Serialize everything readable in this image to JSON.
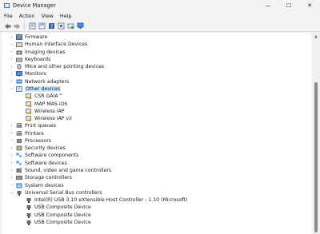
{
  "window": {
    "title": "Device Manager",
    "minimize_glyph": "—",
    "maximize_glyph": "☐",
    "close_glyph": "✕"
  },
  "menu": [
    "File",
    "Action",
    "View",
    "Help"
  ],
  "toolbar": {
    "icons": [
      "back-icon",
      "forward-icon",
      "properties-icon",
      "view-icon",
      "help-icon",
      "update-driver-icon",
      "scan-icon",
      "monitor-icon"
    ]
  },
  "tree": {
    "items": [
      {
        "label": "Firmware",
        "indent": 0,
        "expander": "›",
        "icon": "firmware-icon"
      },
      {
        "label": "Human Interface Devices",
        "indent": 0,
        "expander": "›",
        "icon": "hid-icon"
      },
      {
        "label": "Imaging devices",
        "indent": 0,
        "expander": "›",
        "icon": "camera-icon"
      },
      {
        "label": "Keyboards",
        "indent": 0,
        "expander": "›",
        "icon": "keyboard-icon"
      },
      {
        "label": "Mice and other pointing devices",
        "indent": 0,
        "expander": "›",
        "icon": "mouse-icon"
      },
      {
        "label": "Monitors",
        "indent": 0,
        "expander": "›",
        "icon": "monitor-icon"
      },
      {
        "label": "Network adapters",
        "indent": 0,
        "expander": "›",
        "icon": "network-icon"
      },
      {
        "label": "Other devices",
        "indent": 0,
        "expander": "⌄",
        "icon": "unknown-device-icon",
        "selected": true
      },
      {
        "label": "CSR GAIA™",
        "indent": 1,
        "expander": "",
        "icon": "warning-device-icon"
      },
      {
        "label": "MAP MAS-iOS",
        "indent": 1,
        "expander": "",
        "icon": "warning-device-icon"
      },
      {
        "label": "Wireless iAP",
        "indent": 1,
        "expander": "",
        "icon": "warning-device-icon"
      },
      {
        "label": "Wireless iAP v2",
        "indent": 1,
        "expander": "",
        "icon": "warning-device-icon"
      },
      {
        "label": "Print queues",
        "indent": 0,
        "expander": "›",
        "icon": "printer-icon"
      },
      {
        "label": "Printers",
        "indent": 0,
        "expander": "›",
        "icon": "printer-icon"
      },
      {
        "label": "Processors",
        "indent": 0,
        "expander": "›",
        "icon": "chip-icon"
      },
      {
        "label": "Security devices",
        "indent": 0,
        "expander": "›",
        "icon": "security-icon"
      },
      {
        "label": "Software components",
        "indent": 0,
        "expander": "›",
        "icon": "component-icon"
      },
      {
        "label": "Software devices",
        "indent": 0,
        "expander": "›",
        "icon": "component-icon"
      },
      {
        "label": "Sound, video and game controllers",
        "indent": 0,
        "expander": "›",
        "icon": "speaker-icon"
      },
      {
        "label": "Storage controllers",
        "indent": 0,
        "expander": "›",
        "icon": "storage-icon"
      },
      {
        "label": "System devices",
        "indent": 0,
        "expander": "›",
        "icon": "system-icon"
      },
      {
        "label": "Universal Serial Bus controllers",
        "indent": 0,
        "expander": "⌄",
        "icon": "usb-icon"
      },
      {
        "label": "Intel(R) USB 3.10 eXtensible Host Controller - 1.10 (Microsoft)",
        "indent": 1,
        "expander": "",
        "icon": "usb-icon"
      },
      {
        "label": "USB Composite Device",
        "indent": 1,
        "expander": "",
        "icon": "usb-icon"
      },
      {
        "label": "USB Composite Device",
        "indent": 1,
        "expander": "",
        "icon": "usb-icon"
      },
      {
        "label": "USB Composite Device",
        "indent": 1,
        "expander": "",
        "icon": "usb-icon"
      }
    ]
  },
  "colors": {
    "selection": "#cce8ff",
    "folder_blue": "#3b78c2",
    "warning_yellow": "#e0b000"
  }
}
